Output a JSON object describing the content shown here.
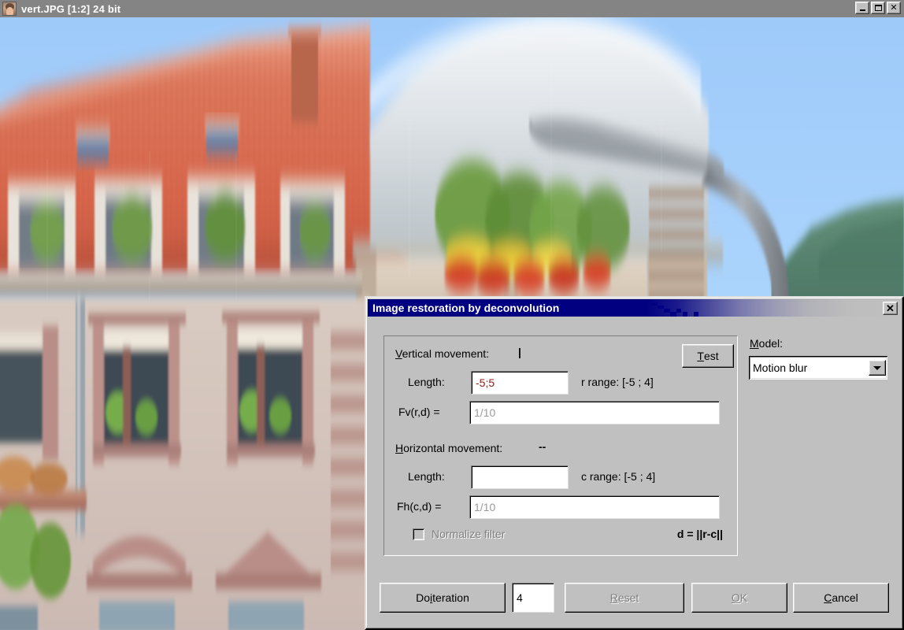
{
  "viewer": {
    "title": "vert.JPG [1:2] 24 bit",
    "icon": "photo-thumbnail-icon",
    "buttons": {
      "minimize": "_",
      "maximize": "□",
      "close": "✕"
    }
  },
  "photo": {
    "description": "Vertically motion-blurred photograph of a building facade with orange tiled roof, flower boxes, blue sky, green hillside and a curved streetlamp",
    "colors": {
      "sky": "#aad4fb",
      "roof": "#e0765a",
      "wall": "#d8c9b8",
      "facade_lower": "#c9a6a2",
      "hill": "#4e7a62",
      "foliage": "#6f9a3e",
      "flowers_red": "#d6462e",
      "flowers_yellow": "#e8c93a",
      "lamp": "#8c9199"
    }
  },
  "dialog": {
    "title": "Image restoration by deconvolution",
    "close_label": "✕",
    "vertical": {
      "group_label": "Vertical movement:",
      "indicator": "|",
      "length_label": "Length:",
      "length_value": "-5;5",
      "length_value_color": "#8b2020",
      "range_label": "r range: [-5 ; 4]",
      "filter_label": "Fv(r,d) =",
      "filter_value": "1/10"
    },
    "horizontal": {
      "group_label": "Horizontal movement:",
      "indicator": "--",
      "length_label": "Length:",
      "length_value": "",
      "range_label": "c range: [-5 ; 4]",
      "filter_label": "Fh(c,d) =",
      "filter_value": "1/10"
    },
    "test_button": {
      "prefix": "T",
      "rest": "est"
    },
    "normalize": {
      "label": "Normalize filter",
      "checked": false,
      "enabled": false
    },
    "distance_note": "d = ||r-c||",
    "model": {
      "label_prefix": "M",
      "label_rest": "odel:",
      "selected": "Motion blur"
    },
    "footer": {
      "do_iteration": {
        "a": "Do ",
        "b": "i",
        "c": "teration"
      },
      "iteration_count": "4",
      "reset": {
        "prefix": "R",
        "rest": "eset"
      },
      "ok": {
        "prefix": "O",
        "rest": "K"
      },
      "cancel": {
        "prefix": "C",
        "rest": "ancel"
      }
    }
  }
}
